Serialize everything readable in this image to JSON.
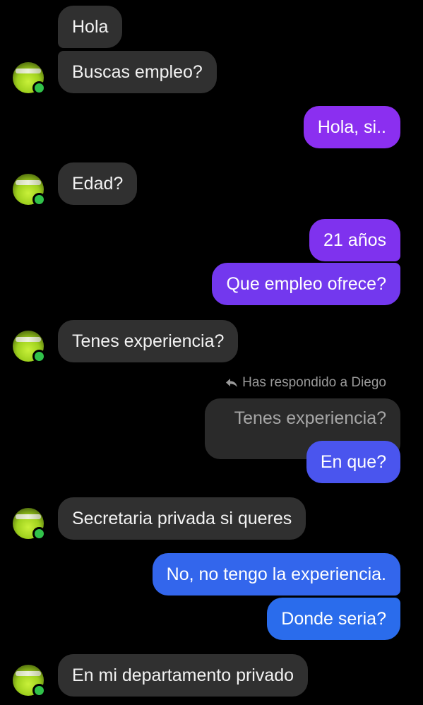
{
  "messages": [
    {
      "text": "Hola"
    },
    {
      "text": "Buscas empleo?"
    },
    {
      "text": "Hola, si.."
    },
    {
      "text": "Edad?"
    },
    {
      "text": "21 años"
    },
    {
      "text": "Que empleo ofrece?"
    },
    {
      "text": "Tenes experiencia?"
    },
    {
      "text": "En que?"
    },
    {
      "text": "Secretaria privada si queres"
    },
    {
      "text": "No, no tengo la experiencia."
    },
    {
      "text": "Donde seria?"
    },
    {
      "text": "En mi departamento privado"
    }
  ],
  "reply": {
    "label": "Has respondido a Diego",
    "quoted_text": "Tenes experiencia?"
  },
  "colors": {
    "incoming": "#303030",
    "outgoing_purple": "#8a2be2",
    "outgoing_blue": "#2f5ff0",
    "online_dot": "#31c24a"
  },
  "icons": {
    "reply": "reply-arrow-icon",
    "avatar": "contact-avatar",
    "online": "online-status-dot"
  }
}
